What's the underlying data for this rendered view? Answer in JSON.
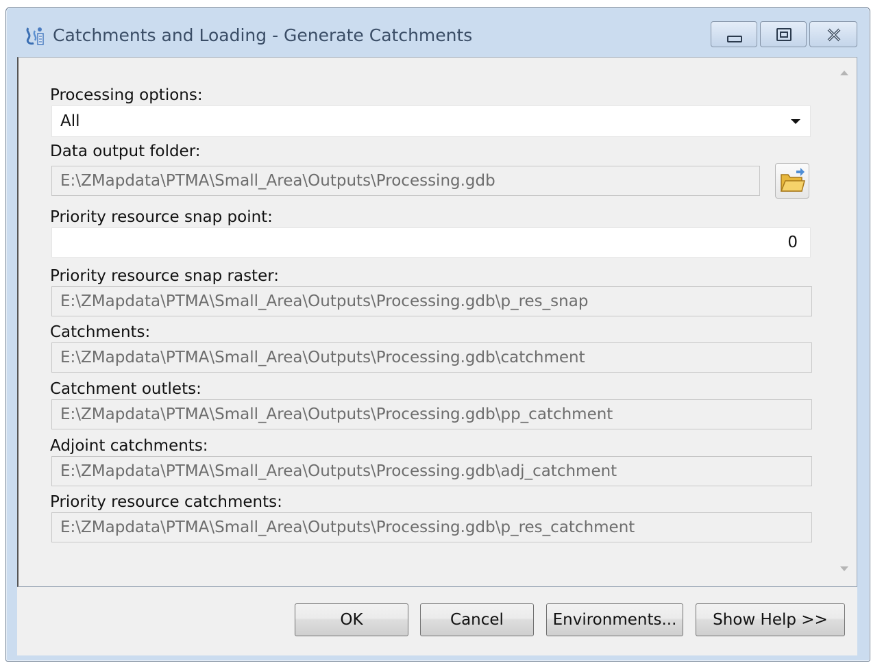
{
  "window": {
    "title": "Catchments and Loading - Generate Catchments"
  },
  "form": {
    "processing_options": {
      "label": "Processing options:",
      "value": "All"
    },
    "data_output_folder": {
      "label": "Data output folder:",
      "value": "E:\\ZMapdata\\PTMA\\Small_Area\\Outputs\\Processing.gdb"
    },
    "priority_snap_point": {
      "label": "Priority resource snap point:",
      "value": "0"
    },
    "priority_snap_raster": {
      "label": "Priority resource snap raster:",
      "value": "E:\\ZMapdata\\PTMA\\Small_Area\\Outputs\\Processing.gdb\\p_res_snap"
    },
    "catchments": {
      "label": "Catchments:",
      "value": "E:\\ZMapdata\\PTMA\\Small_Area\\Outputs\\Processing.gdb\\catchment"
    },
    "catchment_outlets": {
      "label": "Catchment outlets:",
      "value": "E:\\ZMapdata\\PTMA\\Small_Area\\Outputs\\Processing.gdb\\pp_catchment"
    },
    "adjoint_catchments": {
      "label": "Adjoint catchments:",
      "value": "E:\\ZMapdata\\PTMA\\Small_Area\\Outputs\\Processing.gdb\\adj_catchment"
    },
    "priority_catchments": {
      "label": "Priority resource catchments:",
      "value": "E:\\ZMapdata\\PTMA\\Small_Area\\Outputs\\Processing.gdb\\p_res_catchment"
    }
  },
  "buttons": {
    "ok": "OK",
    "cancel": "Cancel",
    "environments": "Environments...",
    "show_help": "Show Help >>"
  },
  "icons": {
    "app": "catchment-tool-icon",
    "browse": "folder-open-icon",
    "dropdown": "caret-down-icon",
    "minimize": "minimize-icon",
    "maximize": "maximize-icon",
    "close": "close-icon",
    "scroll_up": "scroll-up-arrow-icon",
    "scroll_down": "scroll-down-arrow-icon"
  },
  "colors": {
    "title_text": "#3a4d66",
    "window_frame": "#cbdcef",
    "client_bg": "#f0f0f0",
    "disabled_text": "#6d6d6d"
  }
}
